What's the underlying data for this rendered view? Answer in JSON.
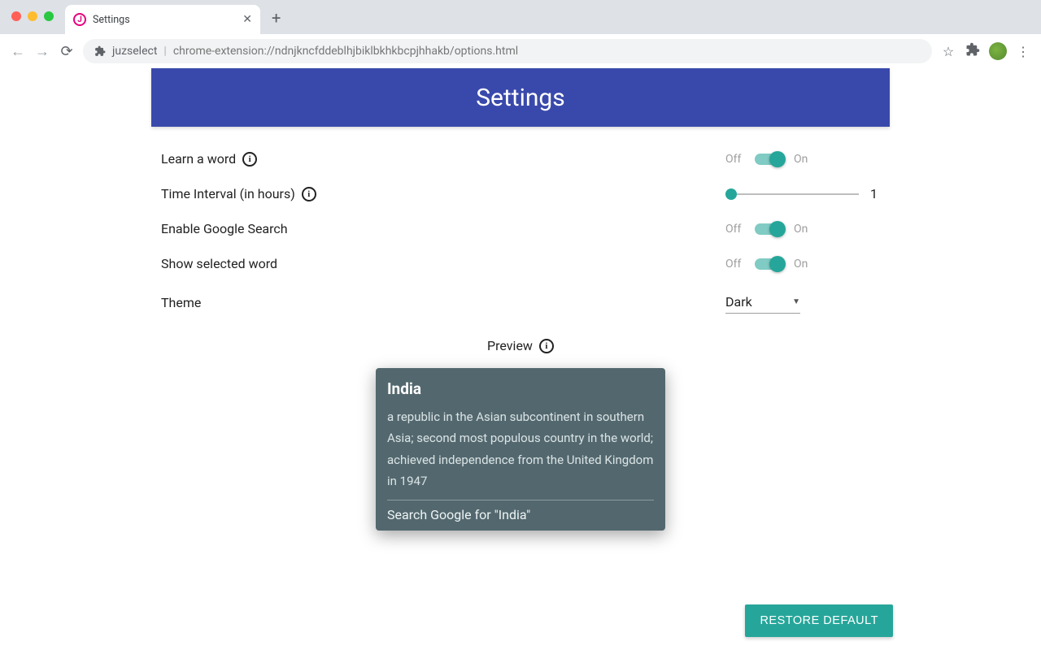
{
  "browser": {
    "tab_title": "Settings",
    "url_host": "juzselect",
    "url_path": "chrome-extension://ndnjkncfddeblhjbiklbkhkbcpjhhakb/options.html"
  },
  "header": {
    "title": "Settings"
  },
  "settings": {
    "learn_word": {
      "label": "Learn a word",
      "off": "Off",
      "on": "On"
    },
    "interval": {
      "label": "Time Interval (in hours)",
      "value": "1"
    },
    "google": {
      "label": "Enable Google Search",
      "off": "Off",
      "on": "On"
    },
    "show_word": {
      "label": "Show selected word",
      "off": "Off",
      "on": "On"
    },
    "theme": {
      "label": "Theme",
      "value": "Dark"
    }
  },
  "preview": {
    "label": "Preview",
    "card": {
      "title": "India",
      "body": "a republic in the Asian subcontinent in southern Asia; second most populous country in the world; achieved independence from the United Kingdom in 1947",
      "action": "Search Google for \"India\""
    }
  },
  "buttons": {
    "restore": "RESTORE DEFAULT"
  }
}
